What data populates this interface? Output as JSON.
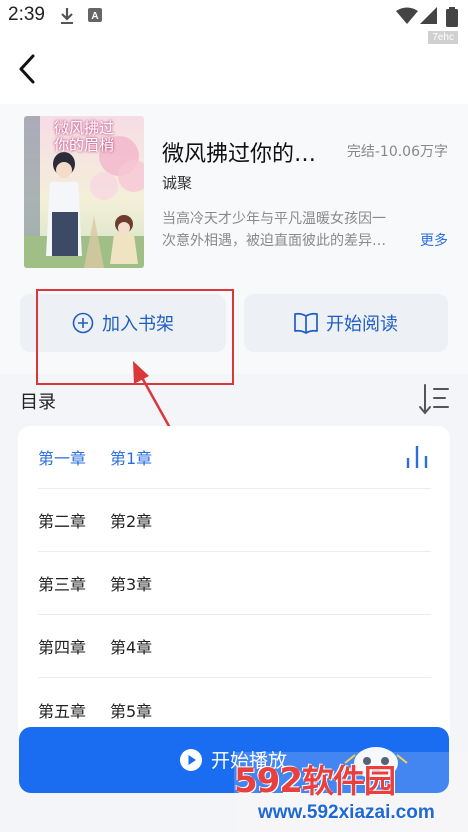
{
  "status_bar": {
    "time": "2:39",
    "icons": [
      "download-icon",
      "keyboard-a-icon",
      "wifi-icon",
      "signal-icon",
      "battery-icon"
    ]
  },
  "watermark_top": "7ehc",
  "nav": {
    "back_icon": "chevron-left-icon"
  },
  "book": {
    "cover_title": [
      "微风拂过",
      "你的眉梢"
    ],
    "title": "微风拂过你的…",
    "status": "完结-10.06万字",
    "author": "诚聚",
    "description_lines": [
      "当高冷天才少年与平凡温暖女孩因一",
      "次意外相遇，被迫直面彼此的差异…"
    ],
    "more": "更多"
  },
  "actions": {
    "add_shelf": "加入书架",
    "start_read": "开始阅读"
  },
  "toc": {
    "title": "目录",
    "chapters": [
      {
        "num": "第一章",
        "name": "第1章"
      },
      {
        "num": "第二章",
        "name": "第2章"
      },
      {
        "num": "第三章",
        "name": "第3章"
      },
      {
        "num": "第四章",
        "name": "第4章"
      },
      {
        "num": "第五章",
        "name": "第5章"
      }
    ]
  },
  "player": {
    "label": "开始播放"
  },
  "watermark": {
    "main_num": "592",
    "main_cn": "软件园",
    "url": "www.592xiazai.com"
  },
  "colors": {
    "accent": "#1a6cf0",
    "link": "#2a6fe0",
    "annotation": "#d9373b",
    "watermark_red": "#e8403f"
  }
}
